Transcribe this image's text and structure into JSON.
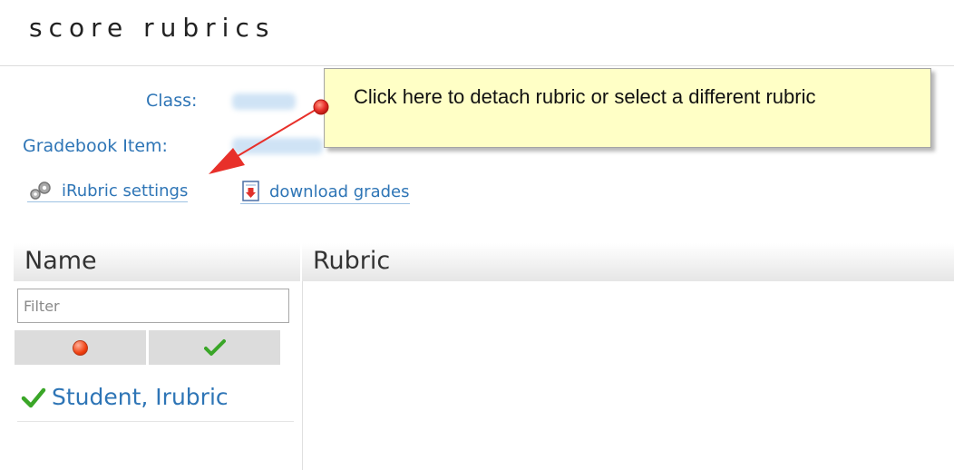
{
  "page": {
    "title": "score rubrics"
  },
  "fields": {
    "class_label": "Class:",
    "gradebook_label": "Gradebook Item:"
  },
  "links": {
    "irubric_settings": "iRubric settings",
    "download_grades": "download grades"
  },
  "callout": {
    "text": "Click here to detach rubric or select a different rubric"
  },
  "table": {
    "columns": [
      "Name",
      "Rubric"
    ],
    "filter_placeholder": "Filter",
    "filter_buttons": [
      {
        "icon": "red-dot-icon",
        "color": "#f04010"
      },
      {
        "icon": "checkmark-icon",
        "color": "#3aa628"
      }
    ],
    "rows": [
      {
        "name": "Student, Irubric",
        "status_icon": "checkmark-icon"
      }
    ]
  },
  "colors": {
    "link": "#2e75b6",
    "callout_bg": "#ffffc6",
    "arrow": "#e8302a",
    "check": "#3aa628"
  }
}
